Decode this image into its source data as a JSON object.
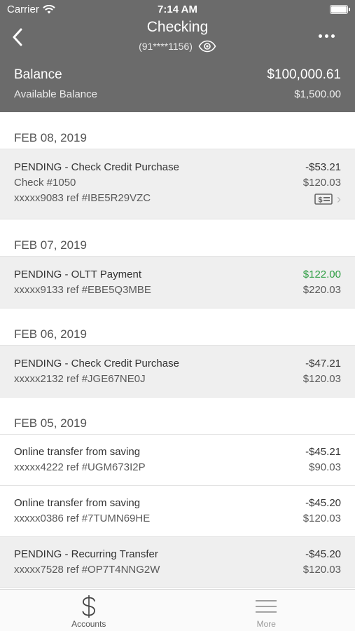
{
  "status_bar": {
    "carrier": "Carrier",
    "time": "7:14 AM"
  },
  "header": {
    "title": "Checking",
    "account_number": "(91****1156)",
    "balance_label": "Balance",
    "balance_value": "$100,000.61",
    "available_label": "Available Balance",
    "available_value": "$1,500.00"
  },
  "groups": [
    {
      "date": "FEB 08, 2019",
      "transactions": [
        {
          "pending": true,
          "description": "PENDING - Check Credit Purchase",
          "amount": "-$53.21",
          "check_number": "Check #1050",
          "balance": "$120.03",
          "ref": "xxxxx9083 ref #IBE5R29VZC",
          "has_check_image": true
        }
      ]
    },
    {
      "date": "FEB 07, 2019",
      "transactions": [
        {
          "pending": true,
          "description": "PENDING - OLTT Payment",
          "amount": "$122.00",
          "positive": true,
          "ref": "xxxxx9133 ref #EBE5Q3MBE",
          "balance": "$220.03"
        }
      ]
    },
    {
      "date": "FEB 06, 2019",
      "transactions": [
        {
          "pending": true,
          "description": "PENDING - Check Credit Purchase",
          "amount": "-$47.21",
          "ref": "xxxxx2132 ref #JGE67NE0J",
          "balance": "$120.03"
        }
      ]
    },
    {
      "date": "FEB 05, 2019",
      "transactions": [
        {
          "pending": false,
          "description": "Online transfer from saving",
          "amount": "-$45.21",
          "ref": "xxxxx4222 ref #UGM673I2P",
          "balance": "$90.03"
        },
        {
          "pending": false,
          "description": "Online transfer from saving",
          "amount": "-$45.20",
          "ref": "xxxxx0386 ref #7TUMN69HE",
          "balance": "$120.03"
        },
        {
          "pending": true,
          "description": "PENDING - Recurring Transfer",
          "amount": "-$45.20",
          "ref": "xxxxx7528 ref #OP7T4NNG2W",
          "balance": "$120.03"
        }
      ]
    }
  ],
  "tab_bar": {
    "accounts_label": "Accounts",
    "more_label": "More"
  },
  "colors": {
    "header_bg": "#6b6b6b",
    "positive_amount": "#2f9e44",
    "pending_row_bg": "#efefef"
  },
  "icons": {
    "back": "chevron-left-icon",
    "view": "eye-icon",
    "menu": "ellipsis-icon",
    "check_image": "check-image-icon",
    "accounts": "dollar-icon",
    "more": "hamburger-icon"
  }
}
